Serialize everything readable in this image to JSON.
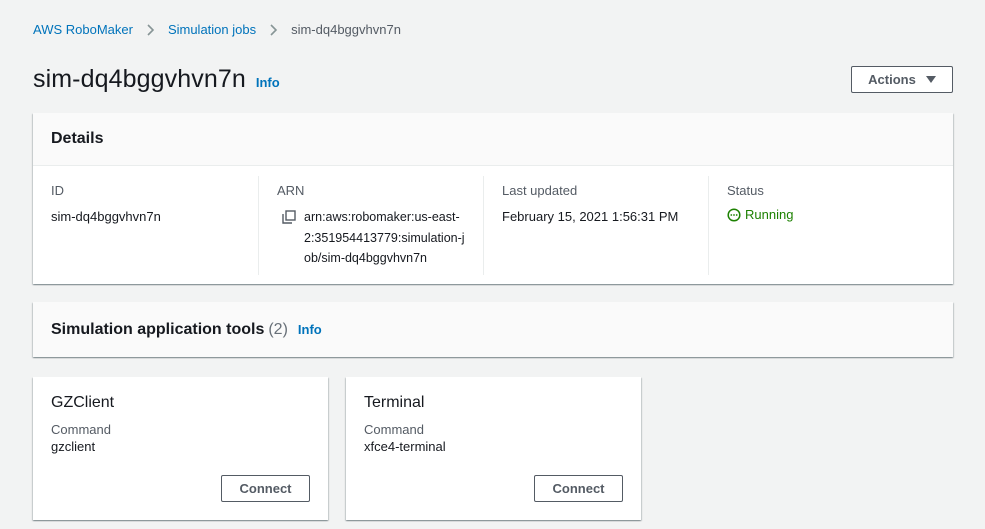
{
  "breadcrumb": {
    "items": [
      "AWS RoboMaker",
      "Simulation jobs",
      "sim-dq4bggvhvn7n"
    ]
  },
  "header": {
    "title": "sim-dq4bggvhvn7n",
    "info": "Info",
    "actions_label": "Actions"
  },
  "details": {
    "heading": "Details",
    "id_label": "ID",
    "id_value": "sim-dq4bggvhvn7n",
    "arn_label": "ARN",
    "arn_value": "arn:aws:robomaker:us-east-2:351954413779:simulation-job/sim-dq4bggvhvn7n",
    "updated_label": "Last updated",
    "updated_value": "February 15, 2021 1:56:31 PM",
    "status_label": "Status",
    "status_value": "Running"
  },
  "tools": {
    "heading": "Simulation application tools",
    "count": "(2)",
    "info": "Info",
    "cards": [
      {
        "name": "GZClient",
        "command_label": "Command",
        "command": "gzclient",
        "button": "Connect"
      },
      {
        "name": "Terminal",
        "command_label": "Command",
        "command": "xfce4-terminal",
        "button": "Connect"
      }
    ]
  },
  "colors": {
    "link": "#0073bb",
    "status_ok": "#1d8102",
    "background": "#f2f3f3"
  }
}
